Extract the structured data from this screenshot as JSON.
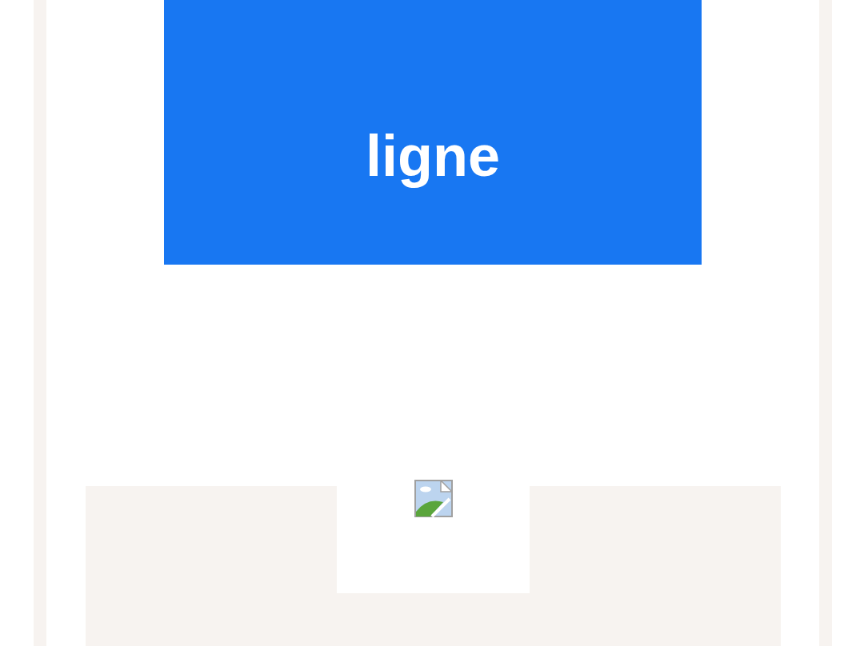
{
  "banner": {
    "text": "ligne"
  },
  "card": {
    "image": {
      "kind": "broken-image"
    }
  }
}
